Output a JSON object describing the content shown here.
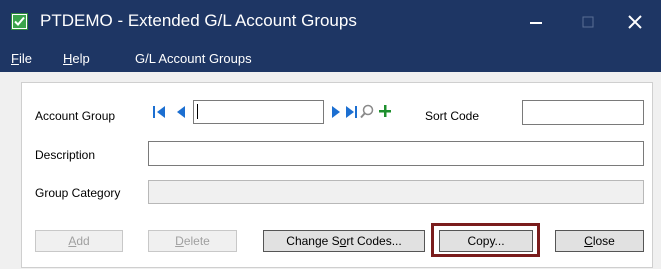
{
  "window": {
    "title": "PTDEMO - Extended G/L Account Groups",
    "icon": "app-check-icon",
    "controls": [
      "minimize",
      "maximize",
      "close"
    ]
  },
  "menu": {
    "file_u": "F",
    "file_rest": "ile",
    "help_u": "H",
    "help_rest": "elp",
    "groups": "G/L Account Groups"
  },
  "form": {
    "account_group_label": "Account Group",
    "account_group_value": "",
    "sort_code_label": "Sort Code",
    "sort_code_value": "",
    "description_label": "Description",
    "description_value": "",
    "group_category_label": "Group Category",
    "group_category_value": ""
  },
  "buttons": {
    "add_u": "A",
    "add_rest": "dd",
    "delete_u": "D",
    "delete_rest": "elete",
    "sort_pre": "Change S",
    "sort_u": "o",
    "sort_rest": "rt Codes...",
    "copy": "Copy...",
    "close_u": "C",
    "close_rest": "lose"
  },
  "colors": {
    "titlebar": "#1e3664",
    "nav_arrows": "#1c6fd1",
    "add_plus": "#1e8f2e",
    "highlight_border": "#7a1c1c"
  }
}
